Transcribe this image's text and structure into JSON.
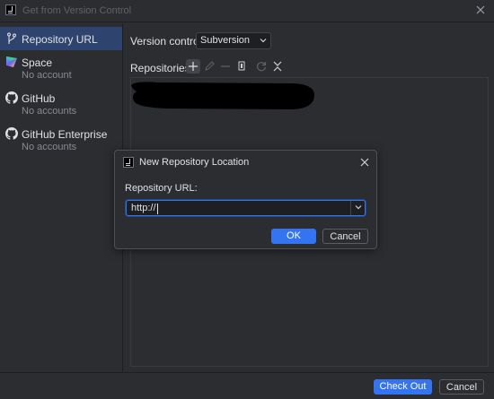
{
  "window": {
    "title": "Get from Version Control"
  },
  "sidebar": {
    "items": [
      {
        "label": "Repository URL",
        "sub": "",
        "icon": "vcs-branch-icon",
        "selected": true
      },
      {
        "label": "Space",
        "sub": "No account",
        "icon": "space-logo-icon",
        "selected": false
      },
      {
        "label": "GitHub",
        "sub": "No accounts",
        "icon": "github-logo-icon",
        "selected": false
      },
      {
        "label": "GitHub Enterprise",
        "sub": "No accounts",
        "icon": "github-logo-icon",
        "selected": false
      }
    ]
  },
  "main": {
    "version_control_label": "Version control:",
    "version_control_value": "Subversion",
    "repositories_label": "Repositories:",
    "toolbar_icons": [
      "add-icon",
      "edit-icon",
      "remove-icon",
      "copy-icon",
      "refresh-icon",
      "collapse-icon"
    ]
  },
  "buttons": {
    "checkout": "Check Out",
    "cancel": "Cancel"
  },
  "dialog": {
    "title": "New Repository Location",
    "url_label": "Repository URL:",
    "url_value": "http://",
    "ok": "OK",
    "cancel": "Cancel"
  },
  "colors": {
    "background": "#2b2d30",
    "selection": "#2e436e",
    "accent": "#3574f0",
    "text": "#dfe1e5",
    "muted": "#868a91"
  }
}
